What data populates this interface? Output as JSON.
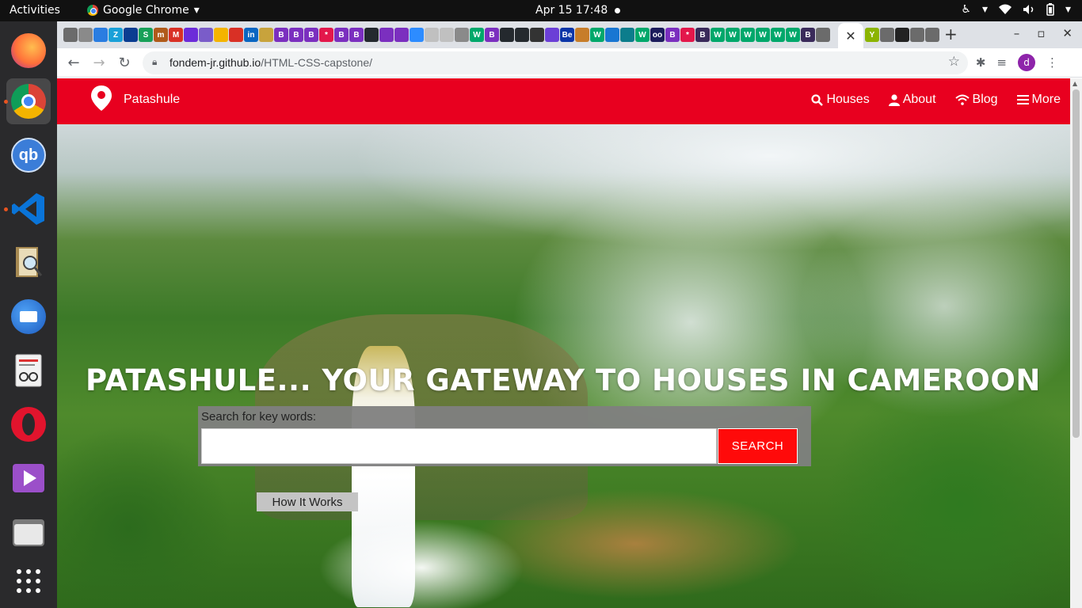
{
  "system_bar": {
    "activities": "Activities",
    "app_name": "Google Chrome",
    "clock": "Apr 15  17:48"
  },
  "dock": {
    "apps": [
      {
        "name": "Firefox",
        "icon": "firefox-icon",
        "color": "#ff7139"
      },
      {
        "name": "Google Chrome",
        "icon": "chrome-icon",
        "color": "#4285f4",
        "active": true
      },
      {
        "name": "qBittorrent",
        "icon": "qbittorrent-icon",
        "color": "#3b7dd8",
        "label": "qb"
      },
      {
        "name": "Visual Studio Code",
        "icon": "vscode-icon",
        "color": "#0a74d8"
      },
      {
        "name": "Document Viewer",
        "icon": "viewer-icon",
        "color": "#a78a52"
      },
      {
        "name": "Thunderbird",
        "icon": "thunderbird-icon",
        "color": "#1d5bbf"
      },
      {
        "name": "Text Editor",
        "icon": "text-editor-icon",
        "color": "#dcdcdc"
      },
      {
        "name": "Opera",
        "icon": "opera-icon",
        "color": "#e2142d"
      },
      {
        "name": "Video Player",
        "icon": "video-player-icon",
        "color": "#9b4fc9"
      },
      {
        "name": "Files",
        "icon": "files-icon",
        "color": "#8a8a8a"
      },
      {
        "name": "Show Applications",
        "icon": "app-grid-icon",
        "color": "#ffffff"
      }
    ]
  },
  "browser": {
    "url_host": "fondem-jr.github.io",
    "url_path": "/HTML-CSS-capstone/",
    "profile_initial": "d",
    "tab_favicons": [
      {
        "c": "#6b6b6b",
        "t": ""
      },
      {
        "c": "#8a8a8a",
        "t": ""
      },
      {
        "c": "#2a7de1",
        "t": ""
      },
      {
        "c": "#19a0d8",
        "t": "Z"
      },
      {
        "c": "#0b3d91",
        "t": ""
      },
      {
        "c": "#18a058",
        "t": "S"
      },
      {
        "c": "#b05a1a",
        "t": "m"
      },
      {
        "c": "#d93025",
        "t": "M"
      },
      {
        "c": "#6c2bd9",
        "t": ""
      },
      {
        "c": "#7a5cc9",
        "t": ""
      },
      {
        "c": "#f4b400",
        "t": ""
      },
      {
        "c": "#d93025",
        "t": ""
      },
      {
        "c": "#0a66c2",
        "t": "in"
      },
      {
        "c": "#c8a33c",
        "t": ""
      },
      {
        "c": "#7b2fbf",
        "t": "B"
      },
      {
        "c": "#7b2fbf",
        "t": "B"
      },
      {
        "c": "#7b2fbf",
        "t": "B"
      },
      {
        "c": "#e3174b",
        "t": "*"
      },
      {
        "c": "#7b2fbf",
        "t": "B"
      },
      {
        "c": "#7b2fbf",
        "t": "B"
      },
      {
        "c": "#24292e",
        "t": ""
      },
      {
        "c": "#7b2fbf",
        "t": ""
      },
      {
        "c": "#7b2fbf",
        "t": ""
      },
      {
        "c": "#2d8cff",
        "t": ""
      },
      {
        "c": "#c0c0c0",
        "t": ""
      },
      {
        "c": "#c0c0c0",
        "t": ""
      },
      {
        "c": "#8a8a8a",
        "t": ""
      },
      {
        "c": "#00a86b",
        "t": "W"
      },
      {
        "c": "#7b2fbf",
        "t": "B"
      },
      {
        "c": "#24292e",
        "t": ""
      },
      {
        "c": "#24292e",
        "t": ""
      },
      {
        "c": "#333333",
        "t": ""
      },
      {
        "c": "#6b3fd6",
        "t": ""
      },
      {
        "c": "#0b35a8",
        "t": "Be"
      },
      {
        "c": "#c77d2a",
        "t": ""
      },
      {
        "c": "#00a86b",
        "t": "W"
      },
      {
        "c": "#1976d2",
        "t": ""
      },
      {
        "c": "#0c7d8c",
        "t": ""
      },
      {
        "c": "#00a86b",
        "t": "W"
      },
      {
        "c": "#1c1c5c",
        "t": "oo"
      },
      {
        "c": "#7b2fbf",
        "t": "B"
      },
      {
        "c": "#e3174b",
        "t": "*"
      },
      {
        "c": "#3a2a5a",
        "t": "B"
      },
      {
        "c": "#00a86b",
        "t": "W"
      },
      {
        "c": "#00a86b",
        "t": "W"
      },
      {
        "c": "#00a86b",
        "t": "W"
      },
      {
        "c": "#00a86b",
        "t": "W"
      },
      {
        "c": "#00a86b",
        "t": "W"
      },
      {
        "c": "#00a86b",
        "t": "W"
      },
      {
        "c": "#3a2a5a",
        "t": "B"
      },
      {
        "c": "#6b6b6b",
        "t": ""
      }
    ],
    "tab_favicons_right": [
      {
        "c": "#8bb400",
        "t": "Y"
      },
      {
        "c": "#6b6b6b",
        "t": ""
      },
      {
        "c": "#222222",
        "t": ""
      },
      {
        "c": "#6b6b6b",
        "t": ""
      },
      {
        "c": "#6b6b6b",
        "t": ""
      }
    ]
  },
  "site": {
    "brand": "Patashule",
    "nav": [
      {
        "label": "Houses",
        "icon": "search-icon"
      },
      {
        "label": "About",
        "icon": "user-icon"
      },
      {
        "label": "Blog",
        "icon": "wifi-icon"
      },
      {
        "label": "More",
        "icon": "menu-icon"
      }
    ],
    "hero_title": "PATASHULE... YOUR GATEWAY TO HOUSES IN CAMEROON",
    "search_label": "Search for key words:",
    "search_value": "",
    "search_button": "SEARCH",
    "how_it_works": "How It Works",
    "colors": {
      "header": "#e8001f",
      "search_button": "#ff0a0a"
    }
  }
}
